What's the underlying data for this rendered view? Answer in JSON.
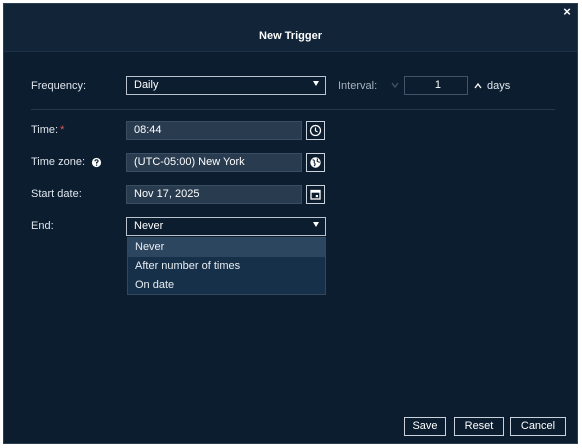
{
  "dialog": {
    "title": "New Trigger",
    "close_label": "×"
  },
  "form": {
    "frequency_label": "Frequency:",
    "frequency_value": "Daily",
    "interval_label": "Interval:",
    "interval_value": "1",
    "interval_unit": "days",
    "time_label": "Time:",
    "required_mark": "*",
    "time_value": "08:44",
    "timezone_label": "Time zone:",
    "timezone_value": "(UTC-05:00) New York",
    "start_date_label": "Start date:",
    "start_date_value": "Nov 17, 2025",
    "end_label": "End:",
    "end_value": "Never"
  },
  "end_options": [
    {
      "label": "Never",
      "selected": true
    },
    {
      "label": "After number of times",
      "selected": false
    },
    {
      "label": "On date",
      "selected": false
    }
  ],
  "footer": {
    "save_label": "Save",
    "reset_label": "Reset",
    "cancel_label": "Cancel"
  },
  "icons": {
    "time": "clock-icon",
    "timezone": "globe-icon",
    "start_date": "calendar-icon",
    "timezone_help": "help-icon"
  }
}
